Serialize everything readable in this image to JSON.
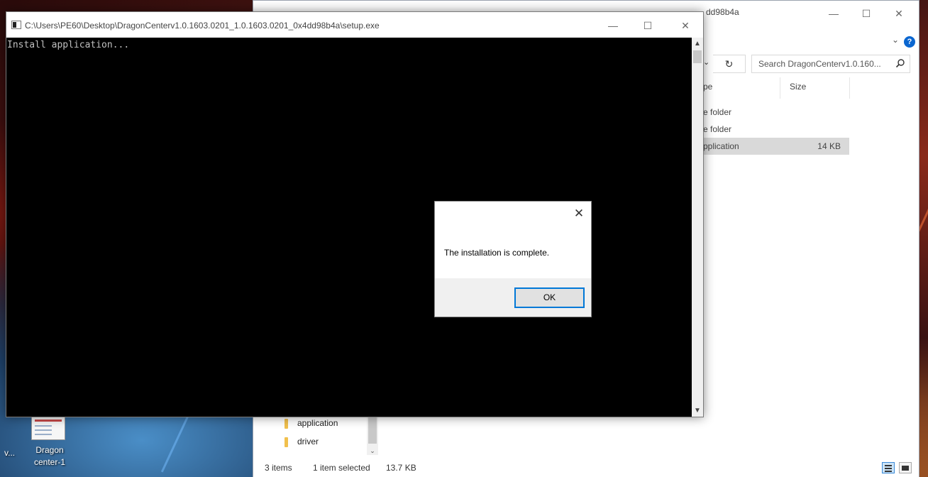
{
  "console_window": {
    "title": "C:\\Users\\PE60\\Desktop\\DragonCenterv1.0.1603.0201_1.0.1603.0201_0x4dd98b4a\\setup.exe",
    "output_text": "Install application...",
    "minimize_glyph": "—",
    "maximize_glyph": "☐",
    "close_glyph": "✕",
    "scroll_up_glyph": "▲",
    "scroll_down_glyph": "▼",
    "app_icon": "console-window-icon"
  },
  "dialog": {
    "close_glyph": "✕",
    "message": "The installation is complete.",
    "ok_label": "OK"
  },
  "explorer_window": {
    "title_fragment": "dd98b4a",
    "minimize_glyph": "—",
    "maximize_glyph": "☐",
    "close_glyph": "✕",
    "ribbon_chevron": "⌄",
    "help_glyph": "?",
    "address_dropdown_glyph": "⌄",
    "refresh_glyph": "↻",
    "search_placeholder": "Search DragonCenterv1.0.160...",
    "columns": {
      "type": "pe",
      "size": "Size"
    },
    "files": [
      {
        "type": "e folder",
        "size": "",
        "selected": false
      },
      {
        "type": "e folder",
        "size": "",
        "selected": false
      },
      {
        "type": "pplication",
        "size": "14 KB",
        "selected": true
      }
    ],
    "nav_items": [
      {
        "label": "application"
      },
      {
        "label": "driver"
      }
    ],
    "nav_scroll_down_glyph": "⌄",
    "status": {
      "items": "3 items",
      "selected": "1 item selected",
      "size": "13.7 KB"
    }
  },
  "desktop": {
    "icon_label_line1": "Dragon",
    "icon_label_line2": "center-1",
    "left_label": "v..."
  }
}
